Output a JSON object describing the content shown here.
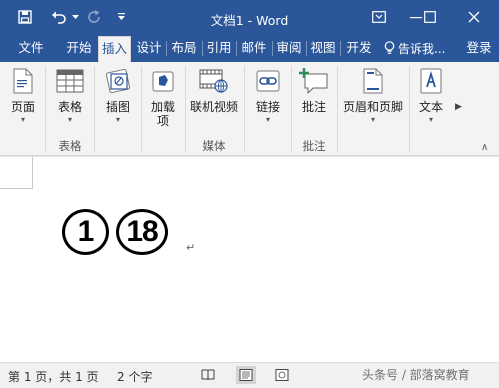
{
  "window": {
    "title": "文档1 - Word",
    "accent": "#2b579a"
  },
  "quick_access": {
    "save_icon": "save-icon",
    "undo_icon": "undo-icon",
    "undo_dropdown_icon": "chevron-down-icon",
    "redo_icon": "redo-icon",
    "customize_icon": "customize-qat-icon"
  },
  "tabs": [
    {
      "label": "文件"
    },
    {
      "label": "开始"
    },
    {
      "label": "插入",
      "active": true
    },
    {
      "label": "设计"
    },
    {
      "label": "布局"
    },
    {
      "label": "引用"
    },
    {
      "label": "邮件"
    },
    {
      "label": "审阅"
    },
    {
      "label": "视图"
    },
    {
      "label": "开发"
    }
  ],
  "tell_me": {
    "label": "告诉我..."
  },
  "sign_in": {
    "label": "登录"
  },
  "ribbon": {
    "buttons": [
      {
        "label": "页面",
        "icon": "pages-icon",
        "dropdown": true
      },
      {
        "label": "表格",
        "icon": "table-icon",
        "dropdown": true
      },
      {
        "label": "插图",
        "icon": "illustrations-icon",
        "dropdown": true
      },
      {
        "label": "加载项",
        "icon": "addins-icon",
        "dropdown": true
      },
      {
        "label": "联机视频",
        "icon": "online-video-icon",
        "dropdown": false
      },
      {
        "label": "链接",
        "icon": "links-icon",
        "dropdown": true
      },
      {
        "label": "批注",
        "icon": "comment-icon",
        "dropdown": false
      },
      {
        "label": "页眉和页脚",
        "icon": "header-footer-icon",
        "dropdown": true
      },
      {
        "label": "文本",
        "icon": "text-icon",
        "dropdown": true
      }
    ],
    "groups": [
      {
        "label": "表格"
      },
      {
        "label": "媒体"
      },
      {
        "label": "批注"
      }
    ]
  },
  "document": {
    "glyphs": [
      "1",
      "18"
    ],
    "paragraph_mark": "↵"
  },
  "status": {
    "page": "第 1 页，共 1 页",
    "words": "2 个字",
    "watermark": "头条号 / 部落窝教育"
  }
}
